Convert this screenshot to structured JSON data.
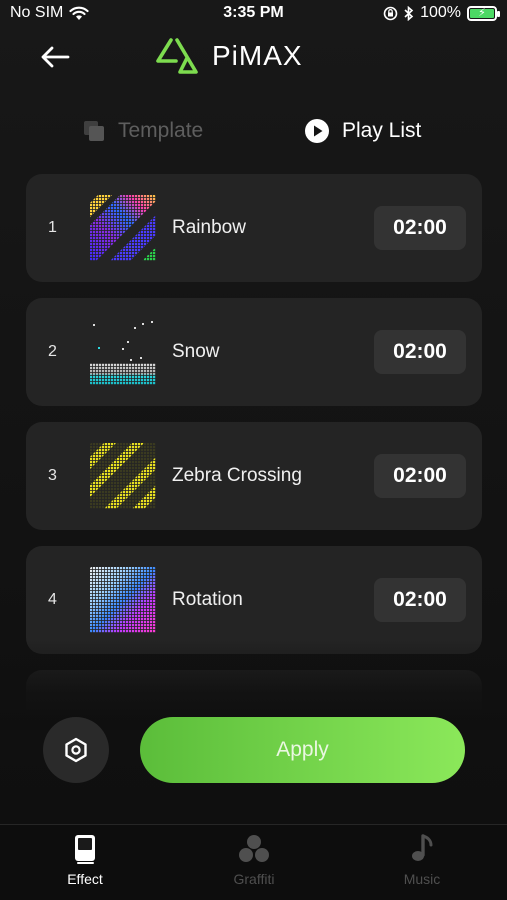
{
  "status_bar": {
    "carrier": "No SIM",
    "time": "3:35 PM",
    "battery": "100%"
  },
  "header": {
    "brand": "PiMAX",
    "back_icon": "arrow-left-icon"
  },
  "tabs": [
    {
      "label": "Template",
      "icon": "template-icon",
      "active": false
    },
    {
      "label": "Play List",
      "icon": "play-circle-icon",
      "active": true
    }
  ],
  "playlist": [
    {
      "index": "1",
      "name": "Rainbow",
      "duration": "02:00"
    },
    {
      "index": "2",
      "name": "Snow",
      "duration": "02:00"
    },
    {
      "index": "3",
      "name": "Zebra Crossing",
      "duration": "02:00"
    },
    {
      "index": "4",
      "name": "Rotation",
      "duration": "02:00"
    }
  ],
  "actions": {
    "apply_label": "Apply",
    "settings_icon": "hexagon-settings-icon"
  },
  "bottom_nav": [
    {
      "label": "Effect",
      "icon": "effect-icon",
      "active": true
    },
    {
      "label": "Graffiti",
      "icon": "graffiti-icon",
      "active": false
    },
    {
      "label": "Music",
      "icon": "music-note-icon",
      "active": false
    }
  ],
  "colors": {
    "accent": "#7ddc4f",
    "background": "#141414",
    "card": "#242424",
    "inactive": "#5e5e5e"
  }
}
